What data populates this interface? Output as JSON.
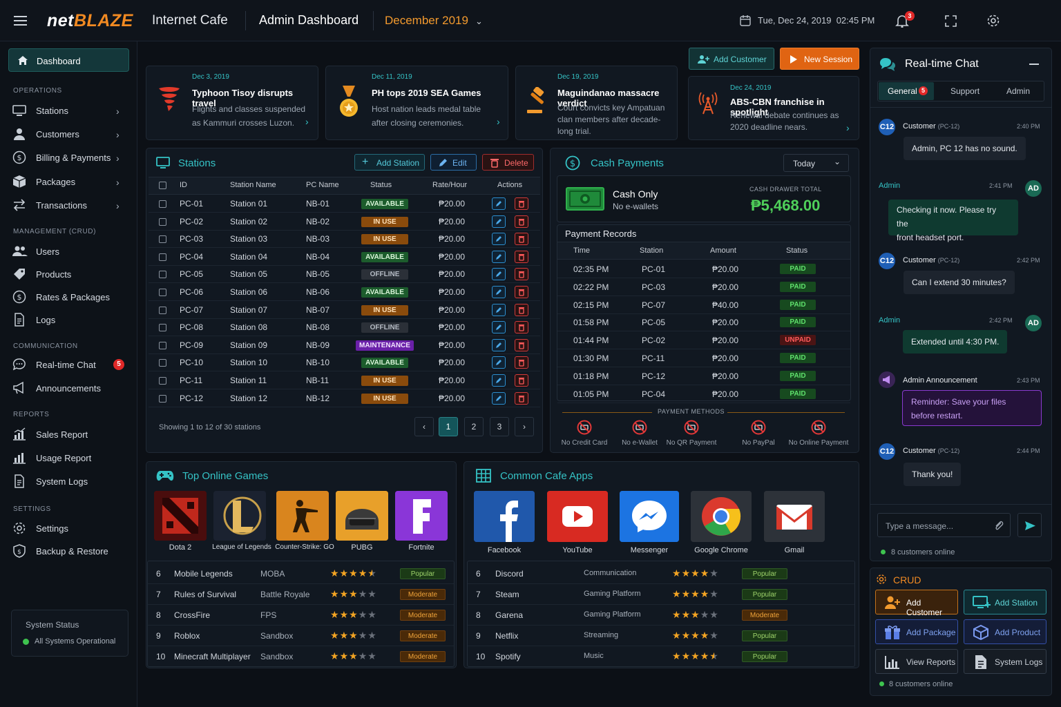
{
  "topbar": {
    "brand_a": "net",
    "brand_b": "BLAZE",
    "brand_sub": "Internet Cafe",
    "title": "Admin Dashboard",
    "month": "December 2019",
    "datetime": "Tue, Dec 24, 2019  02:45 PM",
    "notif_count": "3"
  },
  "sidebar": {
    "dashboard": "Dashboard",
    "sec_operations": "OPERATIONS",
    "stations": "Stations",
    "customers": "Customers",
    "billing": "Billing & Payments",
    "packages": "Packages",
    "transactions": "Transactions",
    "sec_management": "MANAGEMENT (CRUD)",
    "users": "Users",
    "products": "Products",
    "rates": "Rates & Packages",
    "logs": "Logs",
    "sec_communication": "COMMUNICATION",
    "chat": "Real-time Chat",
    "chat_badge": "5",
    "announcements": "Announcements",
    "sec_reports": "REPORTS",
    "sales_report": "Sales Report",
    "usage_report": "Usage Report",
    "system_logs": "System Logs",
    "sec_settings": "SETTINGS",
    "settings": "Settings",
    "backup": "Backup & Restore",
    "status_title": "System Status",
    "status_text": "All Systems Operational"
  },
  "actions": {
    "add_customer": "Add Customer",
    "new_session": "New Session"
  },
  "news": [
    {
      "date": "Dec 3, 2019",
      "title": "Typhoon Tisoy disrupts travel",
      "text": "Flights and classes suspended as Kammuri crosses Luzon."
    },
    {
      "date": "Dec 11, 2019",
      "title": "PH tops 2019 SEA Games",
      "text": "Host nation leads medal table after closing ceremonies."
    },
    {
      "date": "Dec 19, 2019",
      "title": "Maguindanao massacre verdict",
      "text": "Court convicts key Ampatuan clan members after decade-long trial."
    },
    {
      "date": "Dec 24, 2019",
      "title": "ABS-CBN franchise in spotlight",
      "text": "Renewal debate continues as 2020 deadline nears."
    }
  ],
  "stations": {
    "title": "Stations",
    "add": "Add Station",
    "edit": "Edit",
    "delete": "Delete",
    "headers": [
      "ID",
      "Station Name",
      "PC Name",
      "Status",
      "Rate/Hour",
      "Actions"
    ],
    "rows": [
      {
        "id": "PC-01",
        "name": "Station 01",
        "pc": "NB-01",
        "status": "AVAILABLE",
        "rate": "₱20.00"
      },
      {
        "id": "PC-02",
        "name": "Station 02",
        "pc": "NB-02",
        "status": "IN USE",
        "rate": "₱20.00"
      },
      {
        "id": "PC-03",
        "name": "Station 03",
        "pc": "NB-03",
        "status": "IN USE",
        "rate": "₱20.00"
      },
      {
        "id": "PC-04",
        "name": "Station 04",
        "pc": "NB-04",
        "status": "AVAILABLE",
        "rate": "₱20.00"
      },
      {
        "id": "PC-05",
        "name": "Station 05",
        "pc": "NB-05",
        "status": "OFFLINE",
        "rate": "₱20.00"
      },
      {
        "id": "PC-06",
        "name": "Station 06",
        "pc": "NB-06",
        "status": "AVAILABLE",
        "rate": "₱20.00"
      },
      {
        "id": "PC-07",
        "name": "Station 07",
        "pc": "NB-07",
        "status": "IN USE",
        "rate": "₱20.00"
      },
      {
        "id": "PC-08",
        "name": "Station 08",
        "pc": "NB-08",
        "status": "OFFLINE",
        "rate": "₱20.00"
      },
      {
        "id": "PC-09",
        "name": "Station 09",
        "pc": "NB-09",
        "status": "MAINTENANCE",
        "rate": "₱20.00"
      },
      {
        "id": "PC-10",
        "name": "Station 10",
        "pc": "NB-10",
        "status": "AVAILABLE",
        "rate": "₱20.00"
      },
      {
        "id": "PC-11",
        "name": "Station 11",
        "pc": "NB-11",
        "status": "IN USE",
        "rate": "₱20.00"
      },
      {
        "id": "PC-12",
        "name": "Station 12",
        "pc": "NB-12",
        "status": "IN USE",
        "rate": "₱20.00"
      }
    ],
    "footer": "Showing 1 to 12 of 30 stations",
    "pages": [
      "1",
      "2",
      "3"
    ],
    "current_page": "1"
  },
  "cash": {
    "title": "Cash Payments",
    "filter": "Today",
    "mode": "Cash Only",
    "mode_sub": "No e-wallets",
    "drawer_label": "CASH DRAWER TOTAL",
    "drawer_total": "₱5,468.00",
    "records_title": "Payment Records",
    "headers": [
      "Time",
      "Station",
      "Amount",
      "Status"
    ],
    "rows": [
      {
        "time": "02:35 PM",
        "station": "PC-01",
        "amount": "₱20.00",
        "status": "PAID"
      },
      {
        "time": "02:22 PM",
        "station": "PC-03",
        "amount": "₱20.00",
        "status": "PAID"
      },
      {
        "time": "02:15 PM",
        "station": "PC-07",
        "amount": "₱40.00",
        "status": "PAID"
      },
      {
        "time": "01:58 PM",
        "station": "PC-05",
        "amount": "₱20.00",
        "status": "PAID"
      },
      {
        "time": "01:44 PM",
        "station": "PC-02",
        "amount": "₱20.00",
        "status": "UNPAID"
      },
      {
        "time": "01:30 PM",
        "station": "PC-11",
        "amount": "₱20.00",
        "status": "PAID"
      },
      {
        "time": "01:18 PM",
        "station": "PC-12",
        "amount": "₱20.00",
        "status": "PAID"
      },
      {
        "time": "01:05 PM",
        "station": "PC-04",
        "amount": "₱20.00",
        "status": "PAID"
      }
    ],
    "methods_title": "PAYMENT METHODS",
    "methods": [
      "No Credit Card",
      "No e-Wallet",
      "No QR Payment",
      "No PayPal",
      "No Online Payment"
    ]
  },
  "games": {
    "title": "Top Online Games",
    "tiles": [
      "Dota 2",
      "League of Legends",
      "Counter-Strike: GO",
      "PUBG",
      "Fortnite"
    ],
    "rows": [
      {
        "rank": "6",
        "name": "Mobile Legends",
        "genre": "MOBA",
        "stars": 4.5,
        "tag": "Popular"
      },
      {
        "rank": "7",
        "name": "Rules of Survival",
        "genre": "Battle Royale",
        "stars": 3,
        "tag": "Moderate"
      },
      {
        "rank": "8",
        "name": "CrossFire",
        "genre": "FPS",
        "stars": 3,
        "tag": "Moderate"
      },
      {
        "rank": "9",
        "name": "Roblox",
        "genre": "Sandbox",
        "stars": 3,
        "tag": "Moderate"
      },
      {
        "rank": "10",
        "name": "Minecraft Multiplayer",
        "genre": "Sandbox",
        "stars": 3,
        "tag": "Moderate"
      }
    ]
  },
  "apps": {
    "title": "Common Cafe Apps",
    "tiles": [
      "Facebook",
      "YouTube",
      "Messenger",
      "Google Chrome",
      "Gmail"
    ],
    "rows": [
      {
        "rank": "6",
        "name": "Discord",
        "genre": "Communication",
        "stars": 4,
        "tag": "Popular"
      },
      {
        "rank": "7",
        "name": "Steam",
        "genre": "Gaming Platform",
        "stars": 4,
        "tag": "Popular"
      },
      {
        "rank": "8",
        "name": "Garena",
        "genre": "Gaming Platform",
        "stars": 3,
        "tag": "Moderate"
      },
      {
        "rank": "9",
        "name": "Netflix",
        "genre": "Streaming",
        "stars": 4,
        "tag": "Popular"
      },
      {
        "rank": "10",
        "name": "Spotify",
        "genre": "Music",
        "stars": 4.5,
        "tag": "Popular"
      }
    ]
  },
  "chat": {
    "title": "Real-time Chat",
    "tabs": [
      "General",
      "Support",
      "Admin"
    ],
    "general_badge": "5",
    "messages": [
      {
        "avatar": "C12",
        "who": "Customer",
        "sub": "(PC-12)",
        "time": "2:40 PM",
        "text": "Admin, PC 12 has no sound."
      },
      {
        "avatar": "AD",
        "who": "Admin",
        "sub": "",
        "time": "2:41 PM",
        "text1": "Checking it now. Please try the",
        "text2": "front headset port."
      },
      {
        "avatar": "C12",
        "who": "Customer",
        "sub": "(PC-12)",
        "time": "2:42 PM",
        "text": "Can I extend 30 minutes?"
      },
      {
        "avatar": "AD",
        "who": "Admin",
        "sub": "",
        "time": "2:42 PM",
        "text": "Extended until 4:30 PM."
      },
      {
        "avatar": "",
        "who": "Admin Announcement",
        "sub": "",
        "time": "2:43 PM",
        "text1": "Reminder: Save your files",
        "text2": "before restart."
      },
      {
        "avatar": "C12",
        "who": "Customer",
        "sub": "(PC-12)",
        "time": "2:44 PM",
        "text": "Thank you!"
      }
    ],
    "input_placeholder": "Type a message...",
    "online": "8 customers online"
  },
  "crud": {
    "title": "CRUD",
    "buttons": [
      "Add Customer",
      "Add Station",
      "Add Package",
      "Add Product",
      "View Reports",
      "System Logs"
    ],
    "online": "8 customers online"
  },
  "colors": {
    "accent_teal": "#35c3c6",
    "accent_orange": "#f18a22",
    "paid": "#5fe06c",
    "unpaid": "#ff5b5b"
  }
}
